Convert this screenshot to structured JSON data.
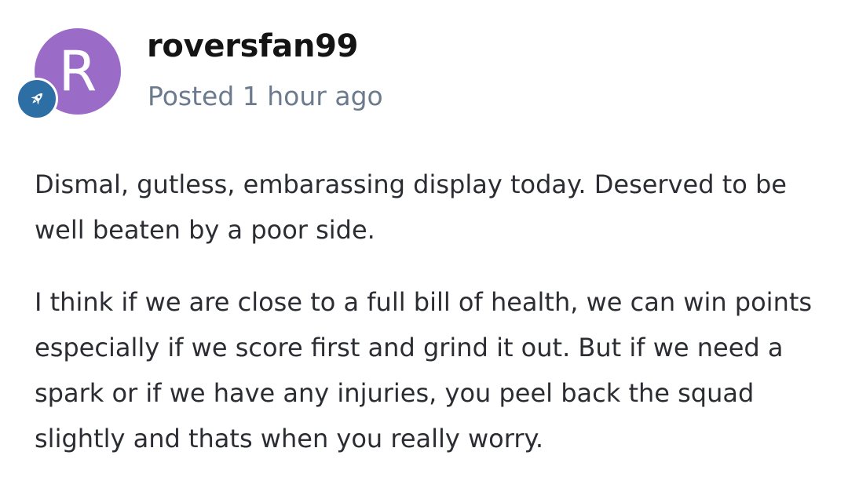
{
  "post": {
    "author": {
      "username": "roversfan99",
      "avatar_letter": "R",
      "avatar_color": "#9b6bc8",
      "badge_icon": "rocket-icon",
      "badge_color": "#2d6ea5"
    },
    "timestamp": "Posted 1 hour ago",
    "paragraphs": [
      "Dismal, gutless, embarassing display today. Deserved to be well beaten by a poor side.",
      "I think if we are close to a full bill of health, we can win points especially if we score first and grind it out. But if we need a spark or if we have any injuries, you peel back the squad slightly and thats when you really worry."
    ]
  }
}
